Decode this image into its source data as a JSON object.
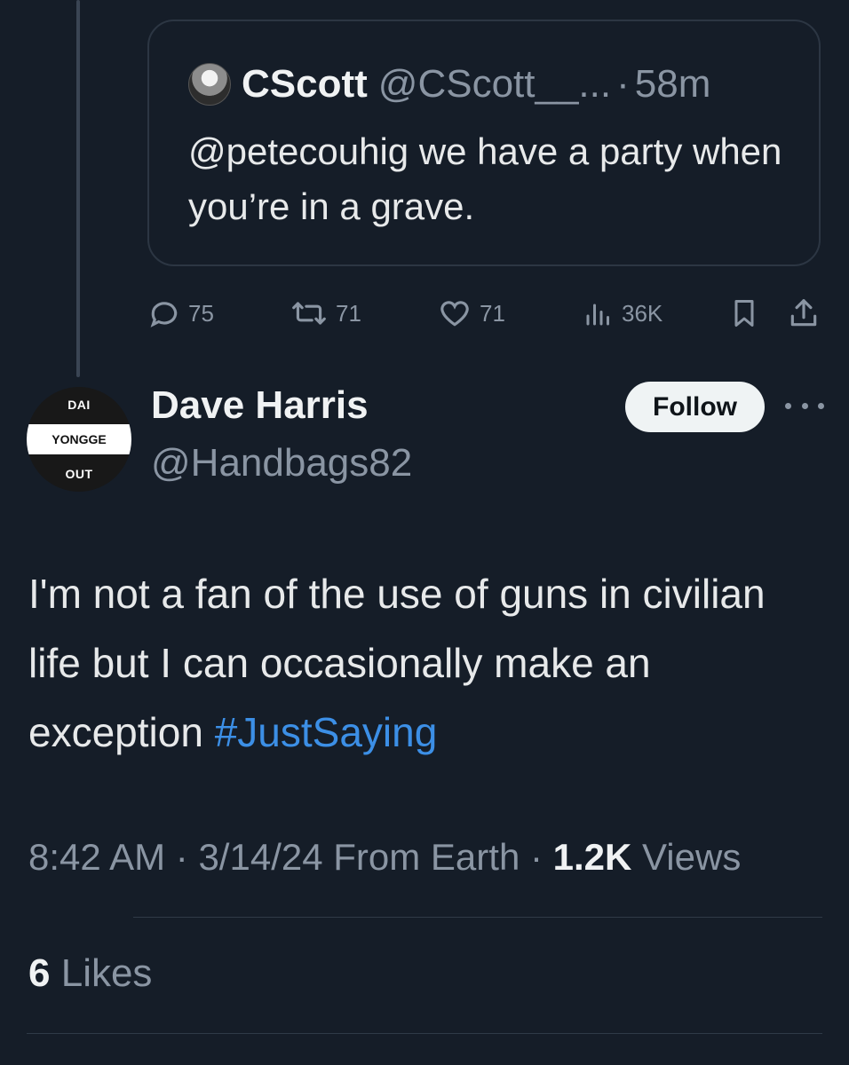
{
  "quoted_tweet": {
    "name": "CScott",
    "handle": "@CScott__...",
    "separator": "·",
    "time": "58m",
    "text": "@petecouhig we have a party when you’re in a grave.",
    "avatar_icon": "profile-photo"
  },
  "actions": {
    "replies": "75",
    "reposts": "71",
    "likes": "71",
    "views": "36K",
    "icons": [
      "reply-icon",
      "repost-icon",
      "like-icon",
      "views-icon",
      "bookmark-icon",
      "share-icon"
    ]
  },
  "author": {
    "name": "Dave Harris",
    "handle": "@Handbags82",
    "avatar_text": {
      "top": "DAI",
      "middle": "YONGGE",
      "bottom": "OUT"
    },
    "follow_label": "Follow"
  },
  "tweet": {
    "text_main": "I'm not a fan of the use of guns in civilian life but I can occasionally make an exception ",
    "hashtag": "#JustSaying",
    "hashtag_color": "#3c8fe6"
  },
  "meta": {
    "time": "8:42 AM",
    "sep1": "·",
    "date": "3/14/24",
    "source": "From Earth",
    "sep2": "·",
    "views_count": "1.2K",
    "views_label": "Views"
  },
  "likes": {
    "count": "6",
    "label": "Likes"
  },
  "colors": {
    "background": "#151d28",
    "secondary_text": "#8a95a3",
    "primary_text": "#e7e9ea",
    "link": "#3c8fe6"
  }
}
